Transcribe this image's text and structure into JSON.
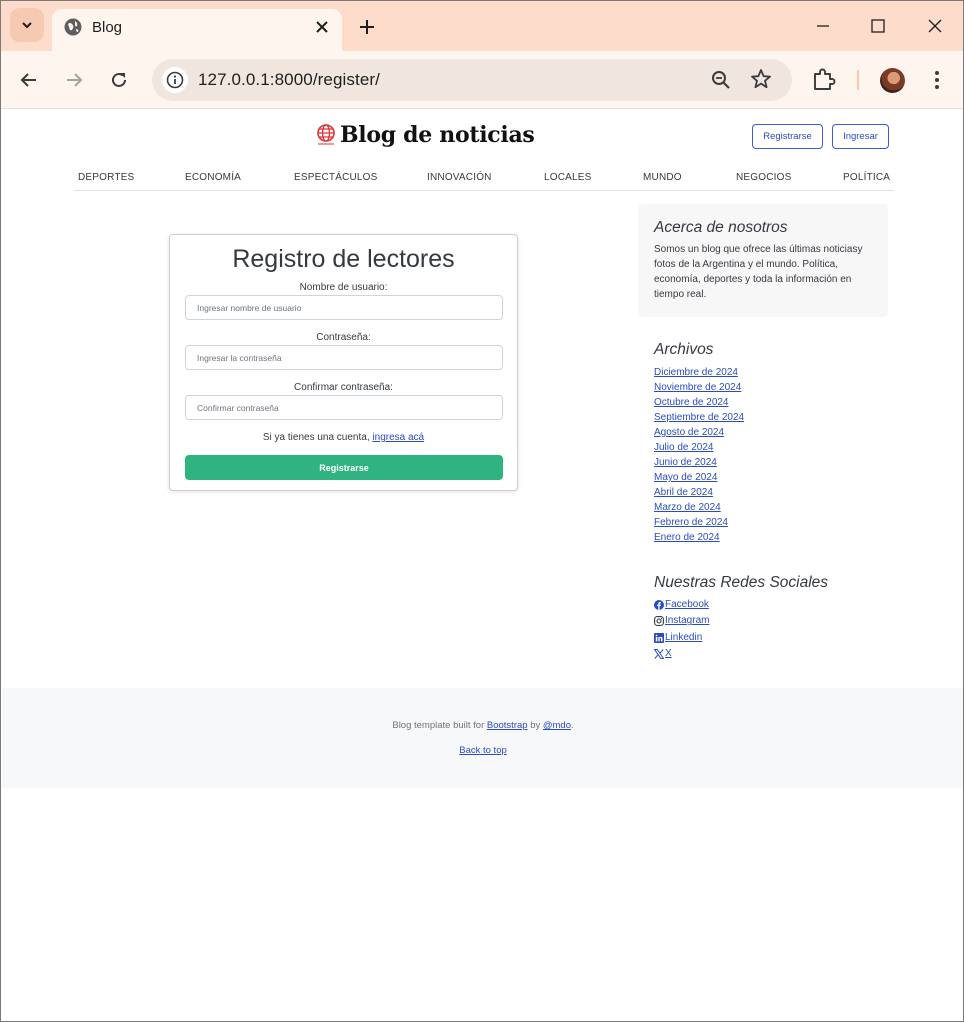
{
  "browser": {
    "tab_title": "Blog",
    "url": "127.0.0.1:8000/register/"
  },
  "header": {
    "brand_name": "Blog de noticias",
    "register_button": "Registrarse",
    "login_button": "Ingresar"
  },
  "nav": {
    "items": [
      "DEPORTES",
      "ECONOMÍA",
      "ESPECTÁCULOS",
      "INNOVACIÓN",
      "LOCALES",
      "MUNDO",
      "NEGOCIOS",
      "POLÍTICA"
    ]
  },
  "form": {
    "title": "Registro de lectores",
    "username_label": "Nombre de usuario:",
    "username_placeholder": "Ingresar nombre de usuario",
    "password_label": "Contraseña:",
    "password_placeholder": "Ingresar la contraseña",
    "confirm_label": "Confirmar contraseña:",
    "confirm_placeholder": "Confirmar contraseña",
    "hint_text": "Si ya tienes una cuenta,",
    "hint_link": "ingresa acá",
    "submit_label": "Registrarse",
    "submit_color": "#2fb380"
  },
  "sidebar": {
    "about_title": "Acerca de nosotros",
    "about_text": "Somos un blog que ofrece las últimas noticiasy fotos de la Argentina y el mundo. Política, economía, deportes y toda la información en tiempo real.",
    "archives_title": "Archivos",
    "archives": [
      "Diciembre de 2024",
      "Noviembre de 2024",
      "Octubre de 2024",
      "Septiembre de 2024",
      "Agosto de 2024",
      "Julio de 2024",
      "Junio de 2024",
      "Mayo de 2024",
      "Abril de 2024",
      "Marzo de 2024",
      "Febrero de 2024",
      "Enero de 2024"
    ],
    "social_title": "Nuestras Redes Sociales",
    "social": [
      {
        "label": " Facebook",
        "icon": "facebook-icon"
      },
      {
        "label": " Instagram",
        "icon": "instagram-icon"
      },
      {
        "label": " Linkedin",
        "icon": "linkedin-icon"
      },
      {
        "label": " X",
        "icon": "x-icon"
      }
    ]
  },
  "footer": {
    "text_before": "Blog template built for ",
    "bootstrap_link": "Bootstrap",
    "text_mid": " by ",
    "mdo_link": "@mdo",
    "text_after": ".",
    "back_to_top": "Back to top"
  },
  "colors": {
    "accent_link": "#2a4cbd",
    "chrome_tabstrip": "#fddccb",
    "chrome_toolbar": "#fff5ef"
  }
}
